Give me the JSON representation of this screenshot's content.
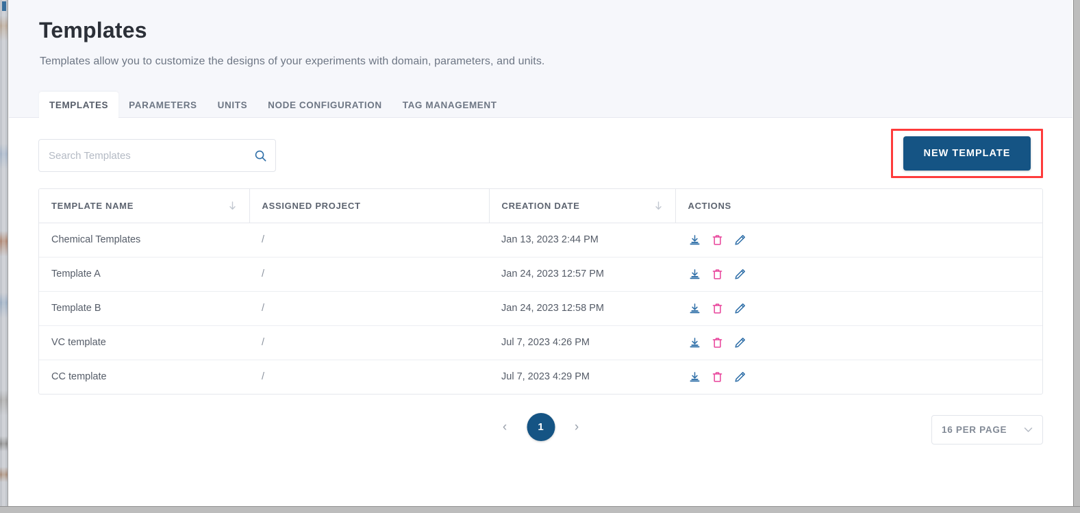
{
  "page": {
    "title": "Templates",
    "subtitle": "Templates allow you to customize the designs of your experiments with domain, parameters, and units."
  },
  "tabs": [
    {
      "label": "TEMPLATES",
      "active": true
    },
    {
      "label": "PARAMETERS",
      "active": false
    },
    {
      "label": "UNITS",
      "active": false
    },
    {
      "label": "NODE CONFIGURATION",
      "active": false
    },
    {
      "label": "TAG MANAGEMENT",
      "active": false
    }
  ],
  "toolbar": {
    "search_placeholder": "Search Templates",
    "search_value": "",
    "search_icon": "search-icon",
    "new_template_label": "NEW TEMPLATE",
    "highlight_color": "#fe3b3b"
  },
  "table": {
    "columns": [
      {
        "label": "TEMPLATE NAME",
        "sortable": true
      },
      {
        "label": "ASSIGNED PROJECT",
        "sortable": false
      },
      {
        "label": "CREATION DATE",
        "sortable": true
      },
      {
        "label": "ACTIONS",
        "sortable": false
      }
    ],
    "rows": [
      {
        "name": "Chemical Templates",
        "project": "/",
        "created": "Jan 13, 2023 2:44 PM"
      },
      {
        "name": "Template A",
        "project": "/",
        "created": "Jan 24, 2023 12:57 PM"
      },
      {
        "name": "Template B",
        "project": "/",
        "created": "Jan 24, 2023 12:58 PM"
      },
      {
        "name": "VC template",
        "project": "/",
        "created": "Jul 7, 2023 4:26 PM"
      },
      {
        "name": "CC template",
        "project": "/",
        "created": "Jul 7, 2023 4:29 PM"
      }
    ],
    "row_actions": [
      {
        "icon": "download-icon",
        "color": "#2f6fa8"
      },
      {
        "icon": "delete-icon",
        "color": "#e8429a"
      },
      {
        "icon": "edit-icon",
        "color": "#2f6fa8"
      }
    ]
  },
  "pagination": {
    "prev_label": "‹",
    "next_label": "›",
    "current_page": "1",
    "per_page_label": "16 PER PAGE",
    "chevron_icon": "chevron-down-icon"
  },
  "colors": {
    "brand_blue": "#155484",
    "header_band": "#f6f7fb",
    "text_primary": "#2c3038",
    "text_muted": "#6d7684"
  }
}
